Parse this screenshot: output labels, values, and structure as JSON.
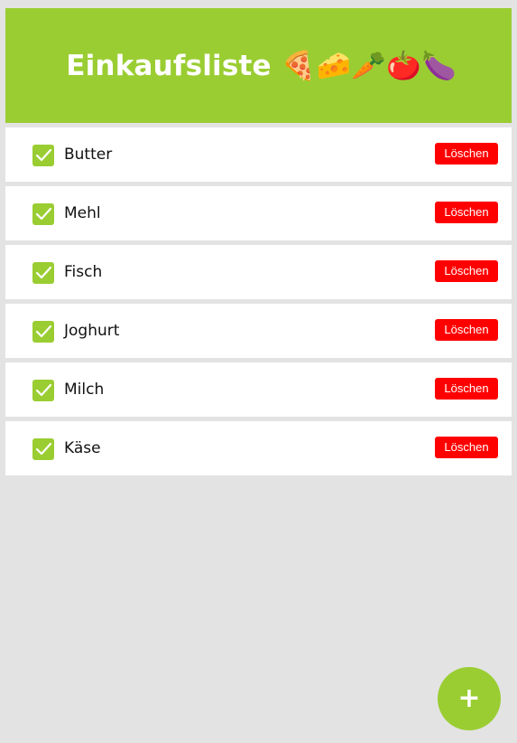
{
  "header": {
    "title": "Einkaufsliste 🍕🧀🥕🍅🍆"
  },
  "items": [
    {
      "label": "Butter",
      "checked": true,
      "delete_label": "Löschen"
    },
    {
      "label": "Mehl",
      "checked": true,
      "delete_label": "Löschen"
    },
    {
      "label": "Fisch",
      "checked": true,
      "delete_label": "Löschen"
    },
    {
      "label": "Joghurt",
      "checked": true,
      "delete_label": "Löschen"
    },
    {
      "label": "Milch",
      "checked": true,
      "delete_label": "Löschen"
    },
    {
      "label": "Käse",
      "checked": true,
      "delete_label": "Löschen"
    }
  ],
  "fab": {
    "label": "+"
  },
  "colors": {
    "accent": "#9acd32",
    "danger": "#ff0000",
    "background": "#e3e3e3"
  }
}
